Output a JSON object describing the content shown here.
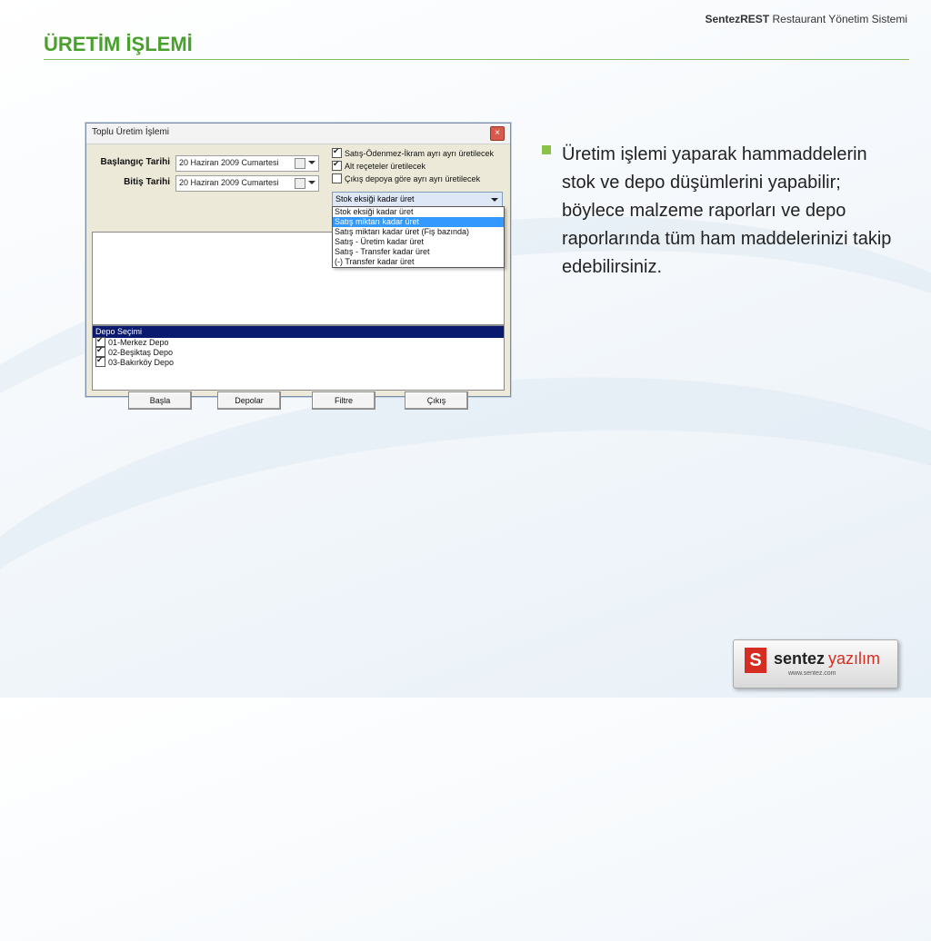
{
  "header": {
    "brand_bold": "SentezREST",
    "brand_rest": "Restaurant Yönetim Sistemi",
    "title": "ÜRETİM İŞLEMİ"
  },
  "window": {
    "title": "Toplu Üretim İşlemi",
    "start_label": "Başlangıç Tarihi",
    "start_value": "20 Haziran 2009 Cumartesi",
    "end_label": "Bitiş Tarihi",
    "end_value": "20 Haziran 2009 Cumartesi",
    "checkboxes": [
      {
        "label": "Satış-Ödenmez-İkram ayrı ayrı üretilecek",
        "checked": true
      },
      {
        "label": "Alt reçeteler üretilecek",
        "checked": true
      },
      {
        "label": "Çıkış depoya göre ayrı ayrı üretilecek",
        "checked": false
      }
    ],
    "combo_value": "Stok eksiği kadar üret",
    "combo_options": [
      "Stok eksiği kadar üret",
      "Satış miktarı kadar üret",
      "Satış miktarı kadar üret (Fiş bazında)",
      "Satış - Üretim kadar üret",
      "Satış - Transfer kadar üret",
      "(-) Transfer kadar üret"
    ],
    "highlighted_option": "Satış miktarı kadar üret",
    "depo_header": "Depo Seçimi",
    "depots": [
      {
        "label": "01-Merkez Depo",
        "checked": true
      },
      {
        "label": "02-Beşiktaş Depo",
        "checked": true
      },
      {
        "label": "03-Bakırköy Depo",
        "checked": true
      }
    ],
    "buttons": [
      "Başla",
      "Depolar",
      "Filtre",
      "Çıkış"
    ]
  },
  "bullet": "Üretim işlemi yaparak hammaddelerin stok ve depo düşümlerini yapabilir; böylece malzeme raporları ve depo raporlarında  tüm ham maddelerinizi takip edebilirsiniz.",
  "logo": {
    "mark": "S",
    "word1": "sentez",
    "word2": "yazılım",
    "url": "www.sentez.com"
  }
}
